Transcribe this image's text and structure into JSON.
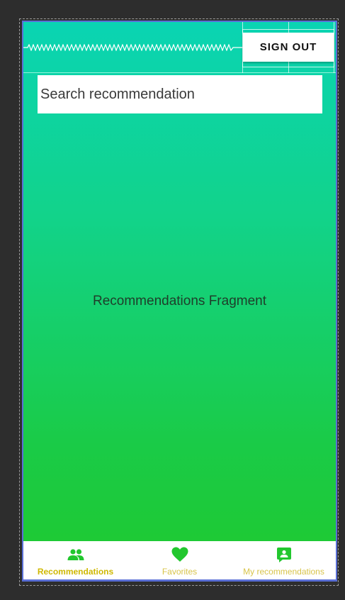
{
  "colors": {
    "gradient_top": "#0ad4b3",
    "gradient_bottom": "#1fc92e",
    "accent_green": "#22c72e",
    "nav_label": "#cfb800"
  },
  "toolbar": {
    "sign_out_label": "SIGN OUT"
  },
  "search": {
    "placeholder": "Search recommendation"
  },
  "main": {
    "fragment_label": "Recommendations Fragment"
  },
  "bottom_nav": {
    "items": [
      {
        "label": "Recommendations",
        "icon": "people-icon",
        "active": true
      },
      {
        "label": "Favorites",
        "icon": "heart-icon",
        "active": false
      },
      {
        "label": "My recommendations",
        "icon": "account-box-icon",
        "active": false
      }
    ]
  }
}
